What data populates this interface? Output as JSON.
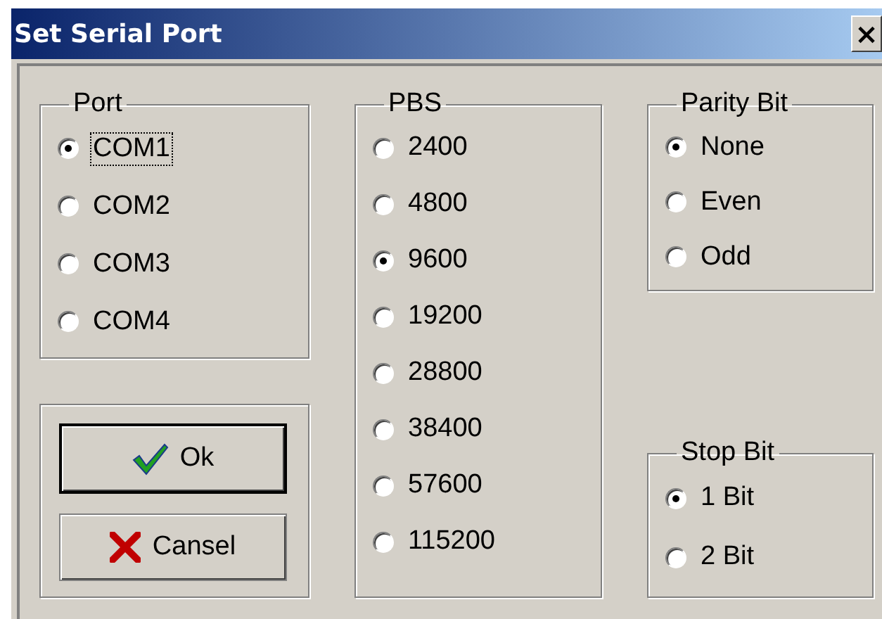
{
  "window": {
    "title": "Set Serial Port",
    "close": "×"
  },
  "port": {
    "title": "Port",
    "options": [
      {
        "label": "COM1",
        "selected": true
      },
      {
        "label": "COM2",
        "selected": false
      },
      {
        "label": "COM3",
        "selected": false
      },
      {
        "label": "COM4",
        "selected": false
      }
    ]
  },
  "buttons": [
    {
      "kind": "ok",
      "label": "Ok"
    },
    {
      "kind": "cancel",
      "label": "Cansel"
    }
  ],
  "pbs": {
    "title": "PBS",
    "options": [
      {
        "label": "2400",
        "selected": false
      },
      {
        "label": "4800",
        "selected": false
      },
      {
        "label": "9600",
        "selected": true
      },
      {
        "label": "19200",
        "selected": false
      },
      {
        "label": "28800",
        "selected": false
      },
      {
        "label": "38400",
        "selected": false
      },
      {
        "label": "57600",
        "selected": false
      },
      {
        "label": "115200",
        "selected": false
      }
    ]
  },
  "parity": {
    "title": "Parity Bit",
    "options": [
      {
        "label": "None",
        "selected": true
      },
      {
        "label": "Even",
        "selected": false
      },
      {
        "label": "Odd",
        "selected": false
      }
    ]
  },
  "stop": {
    "title": "Stop Bit",
    "options": [
      {
        "label": "1 Bit",
        "selected": true
      },
      {
        "label": "2 Bit",
        "selected": false
      }
    ]
  }
}
